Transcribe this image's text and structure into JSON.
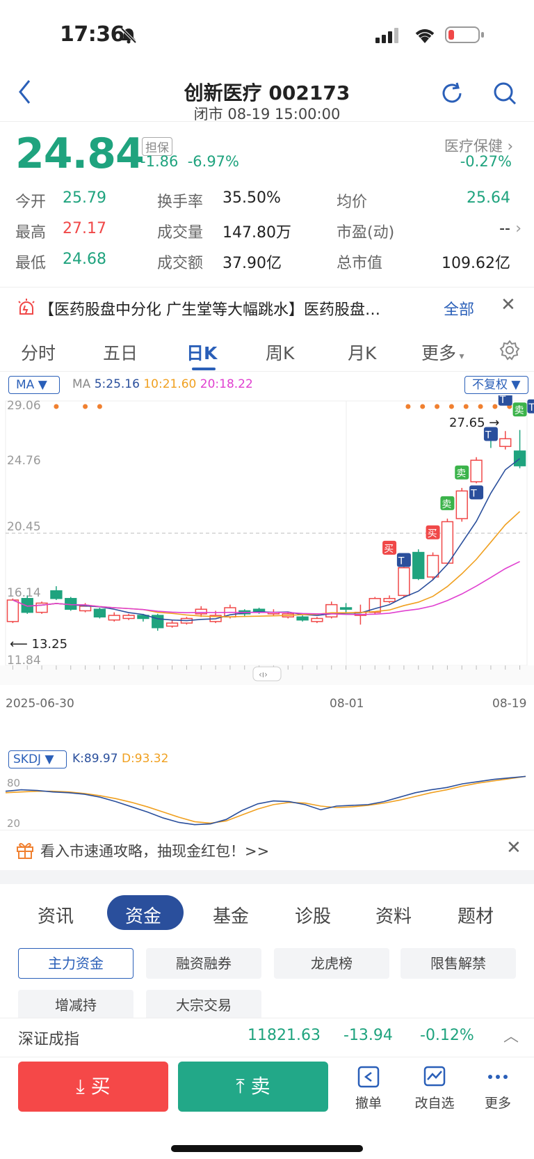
{
  "status_bar": {
    "time": "17:36"
  },
  "nav": {
    "title": "创新医疗 002173",
    "subtitle": "闭市 08-19 15:00:00"
  },
  "quote": {
    "price": "24.84",
    "tag": "担保",
    "change": "-1.86",
    "change_pct": "-6.97%",
    "sector_name": "医疗保健",
    "sector_pct": "-0.27%"
  },
  "stats": [
    {
      "label": "今开",
      "value": "25.79",
      "color": "g"
    },
    {
      "label": "换手率",
      "value": "35.50%",
      "color": "n"
    },
    {
      "label": "均价",
      "value": "25.64",
      "color": "g"
    },
    {
      "label": "最高",
      "value": "27.17",
      "color": "r"
    },
    {
      "label": "成交量",
      "value": "147.80万",
      "color": "n"
    },
    {
      "label": "市盈(动)",
      "value": "--",
      "color": "n"
    },
    {
      "label": "最低",
      "value": "24.68",
      "color": "g"
    },
    {
      "label": "成交额",
      "value": "37.90亿",
      "color": "n"
    },
    {
      "label": "总市值",
      "value": "109.62亿",
      "color": "n"
    }
  ],
  "news": {
    "text": "【医药股盘中分化 广生堂等大幅跳水】医药股盘…",
    "all": "全部"
  },
  "tabs": [
    "分时",
    "五日",
    "日K",
    "周K",
    "月K",
    "更多"
  ],
  "ma_bar": {
    "selector": "MA",
    "label": "MA",
    "ma5": "5:25.16",
    "ma10": "10:21.60",
    "ma20": "20:18.22",
    "fq": "不复权"
  },
  "chart_labels": {
    "y1": "29.06",
    "y2": "24.76",
    "y3": "20.45",
    "y4": "16.14",
    "y5": "11.84",
    "high": "27.65",
    "low": "13.25",
    "d1": "2025-06-30",
    "d2": "08-01",
    "d3": "08-19"
  },
  "colors": {
    "up": "#f04848",
    "down": "#1fa37e",
    "ma5": "#2a4f9c",
    "ma10": "#f0a020",
    "ma20": "#e040d0",
    "accent": "#2a5fb8"
  },
  "chart_data": {
    "type": "candlestick",
    "ylim": [
      11.84,
      29.06
    ],
    "candles": [
      {
        "o": 14.7,
        "c": 16.1,
        "h": 16.2,
        "l": 14.6
      },
      {
        "o": 16.2,
        "c": 15.3,
        "h": 16.4,
        "l": 15.2
      },
      {
        "o": 15.3,
        "c": 15.9,
        "h": 16.0,
        "l": 15.2
      },
      {
        "o": 16.7,
        "c": 16.2,
        "h": 17.0,
        "l": 16.1
      },
      {
        "o": 16.2,
        "c": 15.5,
        "h": 16.3,
        "l": 15.4
      },
      {
        "o": 15.4,
        "c": 15.7,
        "h": 15.9,
        "l": 15.3
      },
      {
        "o": 15.5,
        "c": 15.0,
        "h": 15.6,
        "l": 14.9
      },
      {
        "o": 14.8,
        "c": 15.1,
        "h": 15.3,
        "l": 14.7
      },
      {
        "o": 14.9,
        "c": 15.1,
        "h": 15.2,
        "l": 14.8
      },
      {
        "o": 15.1,
        "c": 14.9,
        "h": 15.2,
        "l": 14.7
      },
      {
        "o": 15.1,
        "c": 14.3,
        "h": 15.2,
        "l": 14.1
      },
      {
        "o": 14.4,
        "c": 14.6,
        "h": 14.8,
        "l": 14.3
      },
      {
        "o": 14.6,
        "c": 14.9,
        "h": 15.0,
        "l": 14.5
      },
      {
        "o": 15.2,
        "c": 15.5,
        "h": 15.7,
        "l": 15.0
      },
      {
        "o": 14.7,
        "c": 15.1,
        "h": 15.4,
        "l": 14.6
      },
      {
        "o": 15.0,
        "c": 15.6,
        "h": 15.8,
        "l": 14.9
      },
      {
        "o": 15.4,
        "c": 15.2,
        "h": 15.5,
        "l": 15.0
      },
      {
        "o": 15.5,
        "c": 15.3,
        "h": 15.6,
        "l": 15.2
      },
      {
        "o": 15.2,
        "c": 15.3,
        "h": 15.5,
        "l": 15.1
      },
      {
        "o": 15.0,
        "c": 15.2,
        "h": 15.3,
        "l": 14.9
      },
      {
        "o": 15.0,
        "c": 14.8,
        "h": 15.1,
        "l": 14.7
      },
      {
        "o": 14.7,
        "c": 14.9,
        "h": 15.0,
        "l": 14.6
      },
      {
        "o": 15.0,
        "c": 15.8,
        "h": 16.0,
        "l": 14.9
      },
      {
        "o": 15.6,
        "c": 15.5,
        "h": 15.9,
        "l": 15.3
      },
      {
        "o": 15.1,
        "c": 15.3,
        "h": 15.8,
        "l": 14.5
      },
      {
        "o": 15.3,
        "c": 16.2,
        "h": 16.3,
        "l": 15.2
      },
      {
        "o": 16.0,
        "c": 16.2,
        "h": 16.4,
        "l": 15.9
      },
      {
        "o": 16.4,
        "c": 18.2,
        "h": 18.3,
        "l": 16.3
      },
      {
        "o": 19.2,
        "c": 17.5,
        "h": 19.4,
        "l": 17.4
      },
      {
        "o": 17.6,
        "c": 19.0,
        "h": 19.2,
        "l": 17.4
      },
      {
        "o": 18.5,
        "c": 21.2,
        "h": 21.4,
        "l": 18.4
      },
      {
        "o": 21.4,
        "c": 23.2,
        "h": 23.4,
        "l": 21.2
      },
      {
        "o": 23.8,
        "c": 25.2,
        "h": 25.4,
        "l": 23.7
      },
      {
        "o": 26.8,
        "c": 26.7,
        "h": 27.2,
        "l": 26.0
      },
      {
        "o": 26.1,
        "c": 26.6,
        "h": 27.1,
        "l": 25.9
      },
      {
        "o": 25.8,
        "c": 24.84,
        "h": 27.17,
        "l": 24.68
      }
    ]
  },
  "indicator": {
    "name": "SKDJ",
    "k": "K:89.97",
    "d": "D:93.32",
    "y_hi": "80",
    "y_lo": "20"
  },
  "promo": {
    "text": "看入市速通攻略，抽现金红包！>>"
  },
  "section_tabs": [
    "资讯",
    "资金",
    "基金",
    "诊股",
    "资料",
    "题材"
  ],
  "pills": [
    "主力资金",
    "融资融券",
    "龙虎榜",
    "限售解禁",
    "增减持",
    "大宗交易"
  ],
  "index": {
    "name": "深证成指",
    "value": "11821.63",
    "chg": "-13.94",
    "pct": "-0.12%"
  },
  "trade": {
    "buy": "买",
    "sell": "卖",
    "cancel": "撤单",
    "watch": "改自选",
    "more": "更多"
  },
  "signals": {
    "buy": "买",
    "sell": "卖",
    "t": "T"
  }
}
